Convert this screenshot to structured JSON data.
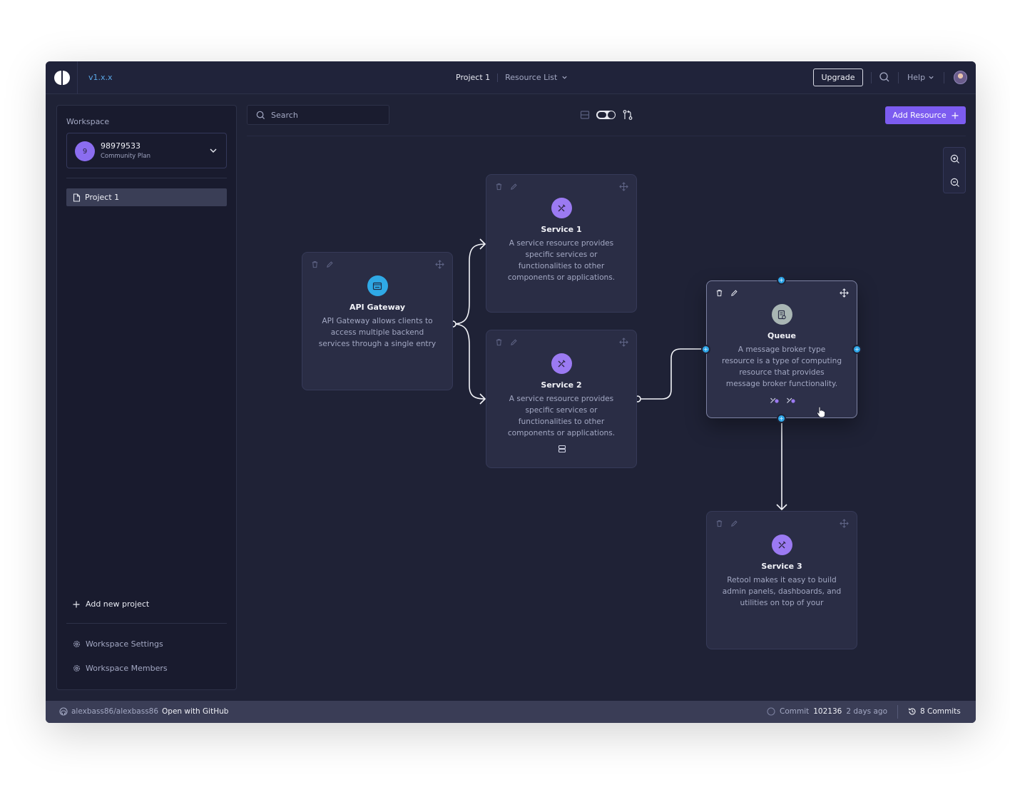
{
  "header": {
    "version": "v1.x.x",
    "project": "Project 1",
    "resource_list": "Resource List",
    "upgrade_label": "Upgrade",
    "help_label": "Help"
  },
  "sidebar": {
    "workspace_label": "Workspace",
    "workspace": {
      "avatar_letter": "9",
      "id": "98979533",
      "plan": "Community Plan"
    },
    "projects": [
      {
        "label": "Project 1"
      }
    ],
    "add_project_label": "Add new project",
    "links": [
      {
        "label": "Workspace Settings"
      },
      {
        "label": "Workspace Members"
      }
    ]
  },
  "toolbar": {
    "search_placeholder": "Search",
    "add_resource_label": "Add Resource"
  },
  "nodes": [
    {
      "title": "API Gateway",
      "description": "API Gateway allows clients to access multiple backend services through a single entry",
      "icon": "api-gateway-icon",
      "color": "#2fa9e6"
    },
    {
      "title": "Service 1",
      "description": "A service resource provides specific services or functionalities to other components or applications.",
      "icon": "tools-icon",
      "color": "#9b7af2"
    },
    {
      "title": "Service 2",
      "description": "A service resource provides specific services or functionalities to other components or applications.",
      "icon": "tools-icon",
      "color": "#9b7af2"
    },
    {
      "title": "Queue",
      "description": "A message broker type resource is a type of computing resource that provides message broker functionality.",
      "icon": "queue-icon",
      "color": "#a9b6b4"
    },
    {
      "title": "Service 3",
      "description": "Retool makes it easy to build admin panels, dashboards, and utilities on top of your",
      "icon": "tools-icon",
      "color": "#9b7af2"
    }
  ],
  "statusbar": {
    "repo": "alexbass86/alexbass86",
    "open_github": "Open with GitHub",
    "commit_label": "Commit",
    "commit_hash": "102136",
    "commit_time": "2 days ago",
    "commits_count": "8 Commits"
  }
}
